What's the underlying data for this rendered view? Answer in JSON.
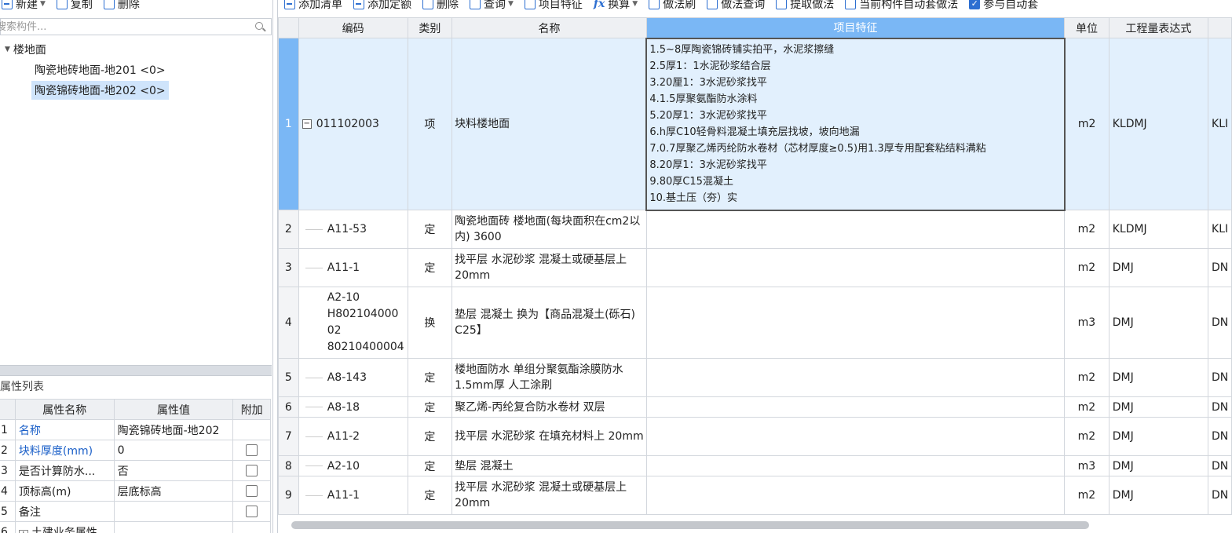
{
  "left_toolbar": {
    "new_label": "新建",
    "copy_label": "复制",
    "delete_label": "删除"
  },
  "search": {
    "placeholder": "搜索构件..."
  },
  "tree": {
    "root": "楼地面",
    "children": [
      "陶瓷地砖地面-地201 <0>",
      "陶瓷锦砖地面-地202 <0>"
    ]
  },
  "properties": {
    "title": "属性列表",
    "headers": [
      "属性名称",
      "属性值",
      "附加"
    ],
    "rows": [
      {
        "num": "1",
        "name": "名称",
        "value": "陶瓷锦砖地面-地202"
      },
      {
        "num": "2",
        "name": "块料厚度(mm)",
        "value": "0"
      },
      {
        "num": "3",
        "name": "是否计算防水...",
        "value": "否"
      },
      {
        "num": "4",
        "name": "顶标高(m)",
        "value": "层底标高"
      },
      {
        "num": "5",
        "name": "备注",
        "value": ""
      },
      {
        "num": "6",
        "name": "土建业务属性",
        "value": ""
      }
    ]
  },
  "right_toolbar": {
    "add_list": "添加清单",
    "add_quota": "添加定额",
    "delete": "删除",
    "query": "查询",
    "item_feature": "项目特征",
    "convert": "换算",
    "method_brush": "做法刷",
    "method_query": "做法查询",
    "extract_method": "提取做法",
    "auto_set": "当前构件自动套做法",
    "participate_auto": "参与自动套"
  },
  "grid": {
    "headers": [
      "编码",
      "类别",
      "名称",
      "项目特征",
      "单位",
      "工程量表达式"
    ],
    "rows": [
      {
        "num": "1",
        "code": "011102003",
        "cat": "项",
        "name": "块料楼地面",
        "features": [
          "1.5~8厚陶瓷锦砖铺实拍平，水泥浆擦缝",
          "2.5厚1：1水泥砂浆结合层",
          "3.20厘1：3水泥砂浆找平",
          "4.1.5厚聚氨酯防水涂料",
          "5.20厚1：3水泥砂浆找平",
          "6.h厚C10轻骨料混凝土填充层找坡，坡向地漏",
          "7.0.7厚聚乙烯丙纶防水卷材（芯材厚度≥0.5)用1.3厚专用配套粘结料满粘",
          "8.20厚1：3水泥砂浆找平",
          "9.80厚C15混凝土",
          "10.基土压（夯）实"
        ],
        "unit": "m2",
        "expr": "KLDMJ",
        "extra": "KLI"
      },
      {
        "num": "2",
        "code": "A11-53",
        "cat": "定",
        "name": "陶瓷地面砖 楼地面(每块面积在cm2以内) 3600",
        "unit": "m2",
        "expr": "KLDMJ",
        "extra": "KLI"
      },
      {
        "num": "3",
        "code": "A11-1",
        "cat": "定",
        "name": "找平层 水泥砂浆 混凝土或硬基层上 20mm",
        "unit": "m2",
        "expr": "DMJ",
        "extra": "DN"
      },
      {
        "num": "4",
        "code_lines": [
          "A2-10",
          "H802104000",
          "02",
          "80210400004"
        ],
        "cat": "换",
        "name": "垫层 混凝土  换为【商品混凝土(砾石) C25】",
        "unit": "m3",
        "expr": "DMJ",
        "extra": "DN"
      },
      {
        "num": "5",
        "code": "A8-143",
        "cat": "定",
        "name": "楼地面防水 单组分聚氨酯涂膜防水 1.5mm厚 人工涂刷",
        "unit": "m2",
        "expr": "DMJ",
        "extra": "DN"
      },
      {
        "num": "6",
        "code": "A8-18",
        "cat": "定",
        "name": "聚乙烯-丙纶复合防水卷材 双层",
        "unit": "m2",
        "expr": "DMJ",
        "extra": "DN"
      },
      {
        "num": "7",
        "code": "A11-2",
        "cat": "定",
        "name": "找平层 水泥砂浆 在填充材料上 20mm",
        "unit": "m2",
        "expr": "DMJ",
        "extra": "DN"
      },
      {
        "num": "8",
        "code": "A2-10",
        "cat": "定",
        "name": "垫层 混凝土",
        "unit": "m3",
        "expr": "DMJ",
        "extra": "DN"
      },
      {
        "num": "9",
        "code": "A11-1",
        "cat": "定",
        "name": "找平层 水泥砂浆 混凝土或硬基层上 20mm",
        "unit": "m2",
        "expr": "DMJ",
        "extra": "DN"
      }
    ]
  },
  "colors": {
    "accent": "#2d6fd1",
    "selected_row": "#e2f0fd",
    "header_highlight": "#7ab7f5",
    "link_blue": "#1a5fc8"
  }
}
